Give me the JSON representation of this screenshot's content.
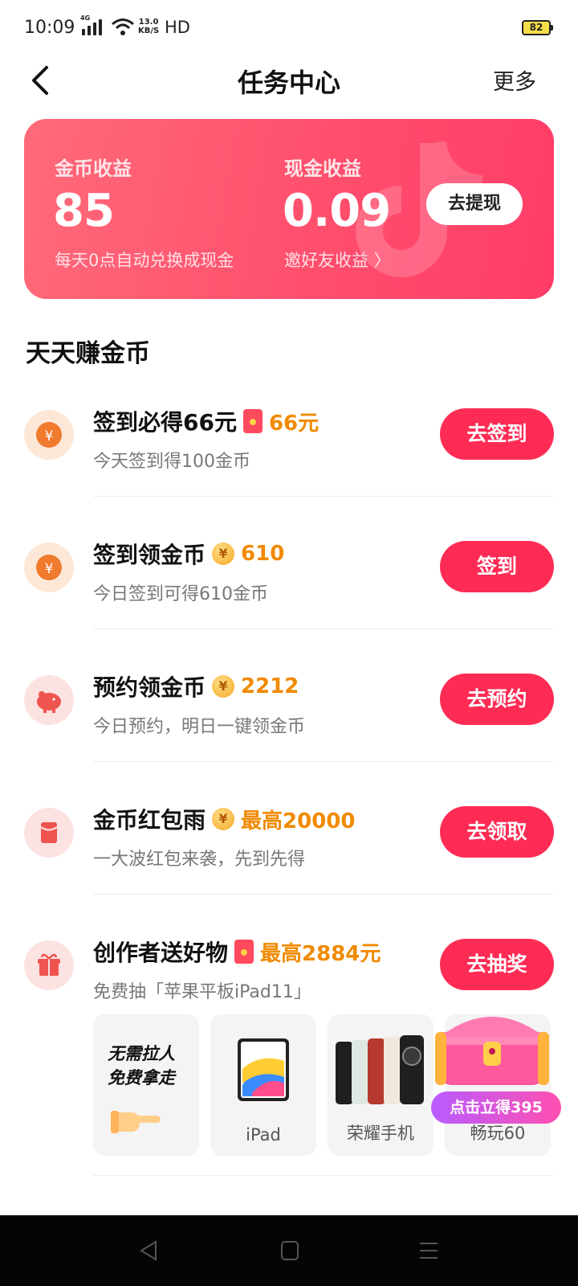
{
  "status_bar": {
    "time": "10:09",
    "network": "4G",
    "speed_top": "13.0",
    "speed_bottom": "KB/S",
    "hd": "HD",
    "battery": "82"
  },
  "nav": {
    "title": "任务中心",
    "more": "更多"
  },
  "earnings": {
    "coin_label": "金币收益",
    "coin_value": "85",
    "coin_sub": "每天0点自动兑换成现金",
    "cash_label": "现金收益",
    "cash_value": "0.09",
    "cash_sub": "邀好友收益 〉",
    "withdraw": "去提现"
  },
  "section_title": "天天赚金币",
  "tasks": [
    {
      "name": "签到必得66元",
      "reward": "66元",
      "desc": "今天签到得100金币",
      "button": "去签到",
      "icon": "yuan-coin-icon"
    },
    {
      "name": "签到领金币",
      "reward": "610",
      "desc": "今日签到可得610金币",
      "button": "签到",
      "icon": "yuan-coin-icon"
    },
    {
      "name": "预约领金币",
      "reward": "2212",
      "desc": "今日预约，明日一键领金币",
      "button": "去预约",
      "icon": "piggy-bank-icon"
    },
    {
      "name": "金币红包雨",
      "reward": "最高20000",
      "desc": "一大波红包来袭，先到先得",
      "button": "去领取",
      "icon": "red-envelope-icon"
    },
    {
      "name": "创作者送好物",
      "reward": "最高2884元",
      "desc": "免费抽「苹果平板iPad11」",
      "button": "去抽奖",
      "icon": "gift-icon"
    }
  ],
  "prizes": {
    "promo_line1": "无需拉人",
    "promo_line2": "免费拿走",
    "ipad": "iPad",
    "honor": "荣耀手机",
    "play": "畅玩60",
    "badge": "点击立得395"
  },
  "colors": {
    "accent": "#fe2c55",
    "reward": "#f08a00",
    "card": "#ff4f6d"
  }
}
